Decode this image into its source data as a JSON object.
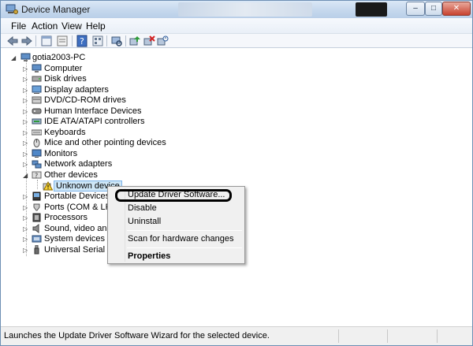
{
  "window": {
    "title": "Device Manager",
    "controls": {
      "minimize": "–",
      "maximize": "□",
      "close": "✕"
    }
  },
  "menu": [
    "File",
    "Action",
    "View",
    "Help"
  ],
  "toolbar_icons": [
    "back-icon",
    "forward-icon",
    "properties-icon",
    "show-hide-icon",
    "help-icon",
    "view-icon",
    "scan-hardware-icon",
    "update-driver-icon",
    "uninstall-icon",
    "disable-icon"
  ],
  "tree": {
    "root": "gotia2003-PC",
    "categories": [
      "Computer",
      "Disk drives",
      "Display adapters",
      "DVD/CD-ROM drives",
      "Human Interface Devices",
      "IDE ATA/ATAPI controllers",
      "Keyboards",
      "Mice and other pointing devices",
      "Monitors",
      "Network adapters",
      "Other devices",
      "Portable Devices",
      "Ports (COM & LPT)",
      "Processors",
      "Sound, video and ga",
      "System devices",
      "Universal Serial Bus c"
    ],
    "selected_child": "Unknown device"
  },
  "context_menu": {
    "items": [
      "Update Driver Software...",
      "Disable",
      "Uninstall",
      "Scan for hardware changes",
      "Properties"
    ]
  },
  "status": "Launches the Update Driver Software Wizard for the selected device.",
  "colors": {
    "title_gradient": "#c7d9ee",
    "selection": "#cde6f7",
    "close_button": "#c8422f"
  }
}
